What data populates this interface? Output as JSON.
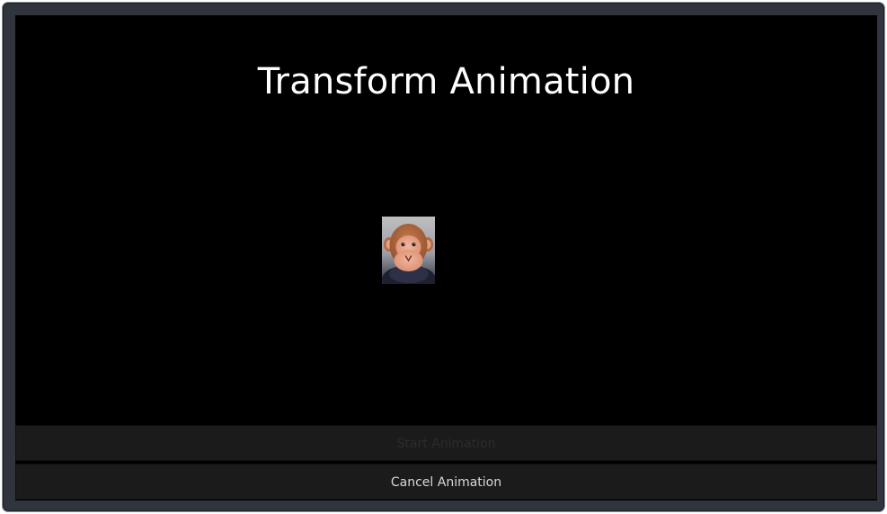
{
  "page": {
    "title": "Transform Animation"
  },
  "image": {
    "icon": "monkey-plush-photo"
  },
  "buttons": {
    "start_label": "Start Animation",
    "start_enabled": false,
    "cancel_label": "Cancel Animation",
    "cancel_enabled": true
  },
  "colors": {
    "screen_background": "#000000",
    "button_background": "#1b1b1b",
    "disabled_text": "#2c2c2c",
    "enabled_text": "#d8d8d8",
    "frame": "#2f343d"
  }
}
